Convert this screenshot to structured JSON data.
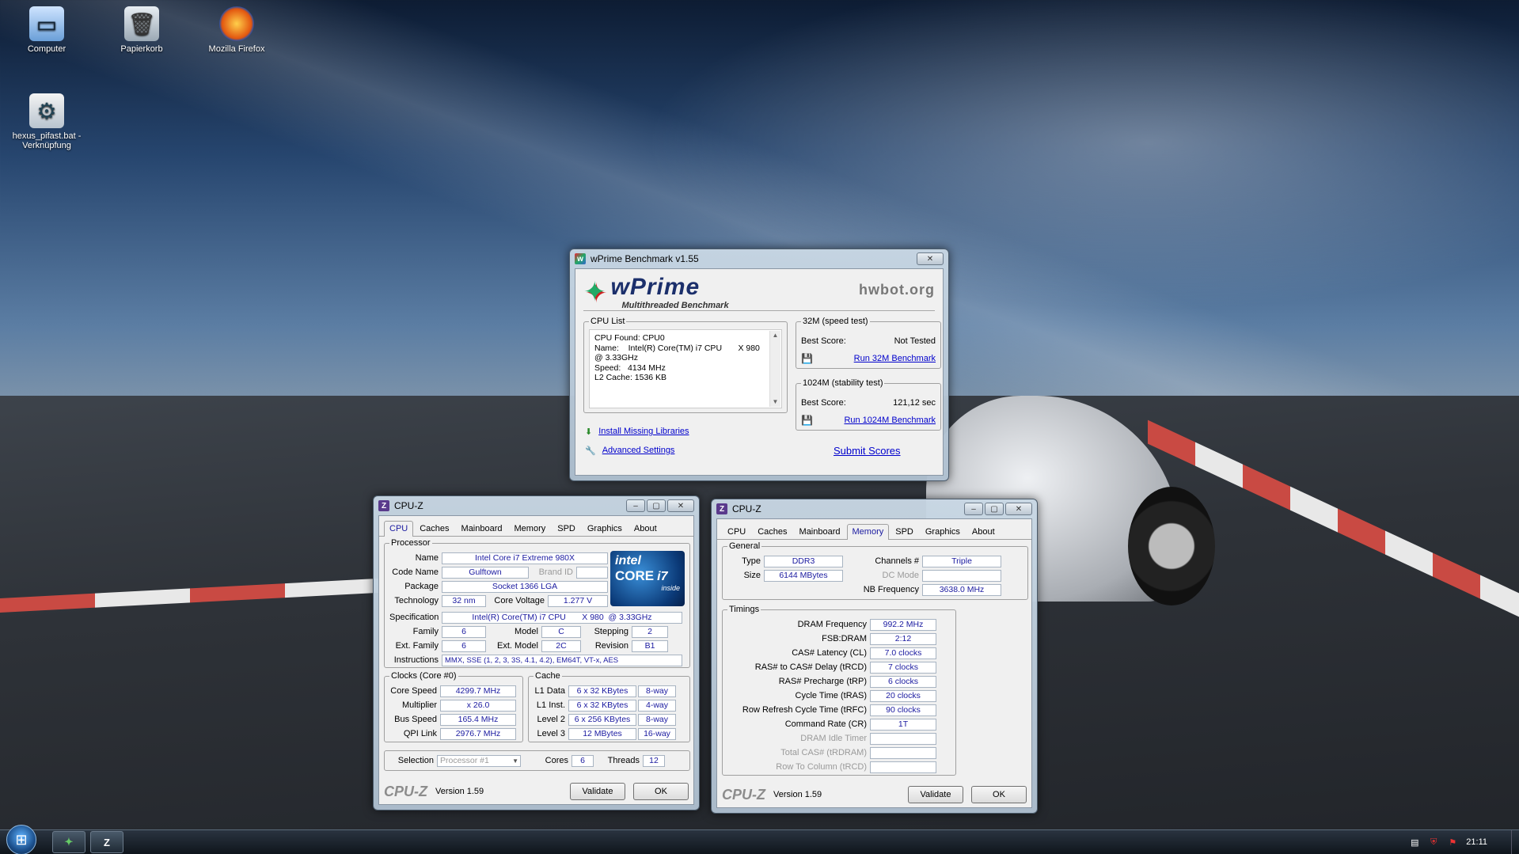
{
  "desktop": {
    "icons": [
      {
        "label": "Computer",
        "icon": "computer-icon"
      },
      {
        "label": "Papierkorb",
        "icon": "recycle-bin-icon"
      },
      {
        "label": "Mozilla Firefox",
        "icon": "firefox-icon"
      },
      {
        "label": "hexus_pifast.bat - Verknüpfung",
        "icon": "batch-file-icon"
      }
    ]
  },
  "wprime": {
    "title": "wPrime Benchmark v1.55",
    "logo": "wPrime",
    "logo_sub": "Multithreaded Benchmark",
    "hwbot": "hwbot.org",
    "cpu_list_legend": "CPU List",
    "cpu_list_lines": [
      "CPU Found: CPU0",
      "Name:    Intel(R) Core(TM) i7 CPU       X 980",
      "@ 3.33GHz",
      "Speed:   4134 MHz",
      "L2 Cache: 1536 KB"
    ],
    "test32_legend": "32M (speed test)",
    "test32_best_label": "Best Score:",
    "test32_best_value": "Not Tested",
    "test32_run": "Run 32M Benchmark",
    "test1024_legend": "1024M (stability test)",
    "test1024_best_label": "Best Score:",
    "test1024_best_value": "121,12 sec",
    "test1024_run": "Run 1024M Benchmark",
    "install_link": "Install Missing Libraries",
    "advanced_link": "Advanced Settings",
    "submit_link": "Submit Scores"
  },
  "cpuz1": {
    "title": "CPU-Z",
    "tabs": [
      "CPU",
      "Caches",
      "Mainboard",
      "Memory",
      "SPD",
      "Graphics",
      "About"
    ],
    "active_tab": "CPU",
    "processor_legend": "Processor",
    "name_label": "Name",
    "name_value": "Intel Core i7 Extreme 980X",
    "codename_label": "Code Name",
    "codename_value": "Gulftown",
    "brandid_label": "Brand ID",
    "brandid_value": "",
    "package_label": "Package",
    "package_value": "Socket 1366 LGA",
    "technology_label": "Technology",
    "technology_value": "32 nm",
    "corevoltage_label": "Core Voltage",
    "corevoltage_value": "1.277 V",
    "spec_label": "Specification",
    "spec_value": "Intel(R) Core(TM) i7 CPU       X 980  @ 3.33GHz",
    "family_label": "Family",
    "family_value": "6",
    "model_label": "Model",
    "model_value": "C",
    "stepping_label": "Stepping",
    "stepping_value": "2",
    "extfamily_label": "Ext. Family",
    "extfamily_value": "6",
    "extmodel_label": "Ext. Model",
    "extmodel_value": "2C",
    "revision_label": "Revision",
    "revision_value": "B1",
    "instructions_label": "Instructions",
    "instructions_value": "MMX, SSE (1, 2, 3, 3S, 4.1, 4.2), EM64T, VT-x, AES",
    "intel_badge": {
      "brand": "intel",
      "line": "CORE",
      "model": "i7",
      "tag": "inside"
    },
    "clocks_legend": "Clocks (Core #0)",
    "corespeed_label": "Core Speed",
    "corespeed_value": "4299.7 MHz",
    "multiplier_label": "Multiplier",
    "multiplier_value": "x 26.0",
    "busspeed_label": "Bus Speed",
    "busspeed_value": "165.4 MHz",
    "qpilink_label": "QPI Link",
    "qpilink_value": "2976.7 MHz",
    "cache_legend": "Cache",
    "cache_rows": [
      {
        "label": "L1 Data",
        "size": "6 x 32 KBytes",
        "way": "8-way"
      },
      {
        "label": "L1 Inst.",
        "size": "6 x 32 KBytes",
        "way": "4-way"
      },
      {
        "label": "Level 2",
        "size": "6 x 256 KBytes",
        "way": "8-way"
      },
      {
        "label": "Level 3",
        "size": "12 MBytes",
        "way": "16-way"
      }
    ],
    "selection_label": "Selection",
    "selection_value": "Processor #1",
    "cores_label": "Cores",
    "cores_value": "6",
    "threads_label": "Threads",
    "threads_value": "12",
    "logo": "CPU-Z",
    "version": "Version 1.59",
    "validate": "Validate",
    "ok": "OK"
  },
  "cpuz2": {
    "title": "CPU-Z",
    "tabs": [
      "CPU",
      "Caches",
      "Mainboard",
      "Memory",
      "SPD",
      "Graphics",
      "About"
    ],
    "active_tab": "Memory",
    "general_legend": "General",
    "type_label": "Type",
    "type_value": "DDR3",
    "channels_label": "Channels #",
    "channels_value": "Triple",
    "size_label": "Size",
    "size_value": "6144 MBytes",
    "dcmode_label": "DC Mode",
    "dcmode_value": "",
    "nbfreq_label": "NB Frequency",
    "nbfreq_value": "3638.0 MHz",
    "timings_legend": "Timings",
    "timings": [
      {
        "label": "DRAM Frequency",
        "value": "992.2 MHz",
        "disabled": false
      },
      {
        "label": "FSB:DRAM",
        "value": "2:12",
        "disabled": false
      },
      {
        "label": "CAS# Latency (CL)",
        "value": "7.0 clocks",
        "disabled": false
      },
      {
        "label": "RAS# to CAS# Delay (tRCD)",
        "value": "7 clocks",
        "disabled": false
      },
      {
        "label": "RAS# Precharge (tRP)",
        "value": "6 clocks",
        "disabled": false
      },
      {
        "label": "Cycle Time (tRAS)",
        "value": "20 clocks",
        "disabled": false
      },
      {
        "label": "Row Refresh Cycle Time (tRFC)",
        "value": "90 clocks",
        "disabled": false
      },
      {
        "label": "Command Rate (CR)",
        "value": "1T",
        "disabled": false
      },
      {
        "label": "DRAM Idle Timer",
        "value": "",
        "disabled": true
      },
      {
        "label": "Total CAS# (tRDRAM)",
        "value": "",
        "disabled": true
      },
      {
        "label": "Row To Column (tRCD)",
        "value": "",
        "disabled": true
      }
    ],
    "logo": "CPU-Z",
    "version": "Version 1.59",
    "validate": "Validate",
    "ok": "OK"
  },
  "taskbar": {
    "clock": "21:11",
    "tasks": [
      {
        "icon": "wprime-icon"
      },
      {
        "icon": "cpuz-icon",
        "label": "Z"
      }
    ]
  }
}
